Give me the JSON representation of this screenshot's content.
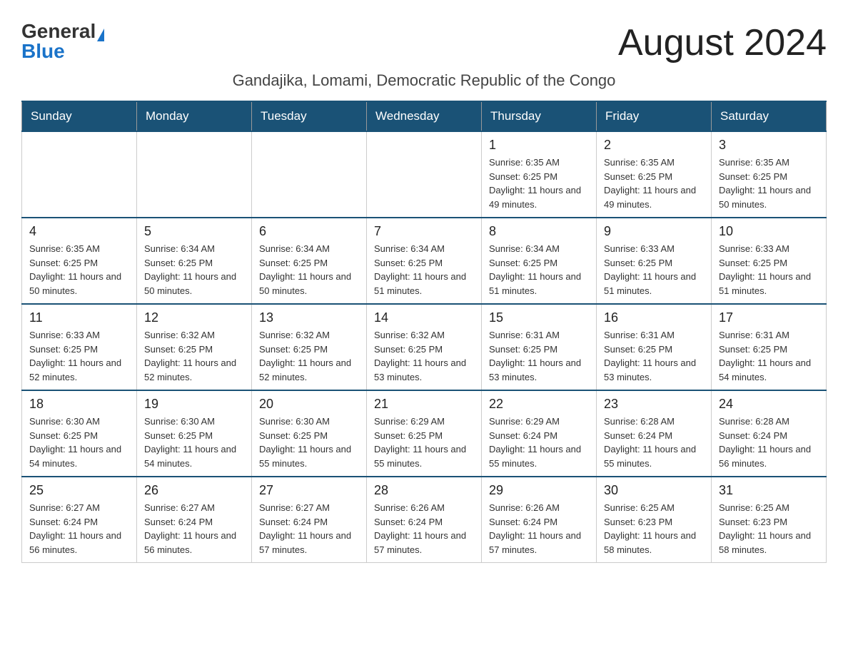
{
  "logo": {
    "general": "General",
    "blue": "Blue"
  },
  "title": "August 2024",
  "location": "Gandajika, Lomami, Democratic Republic of the Congo",
  "days_of_week": [
    "Sunday",
    "Monday",
    "Tuesday",
    "Wednesday",
    "Thursday",
    "Friday",
    "Saturday"
  ],
  "weeks": [
    [
      {
        "day": "",
        "info": ""
      },
      {
        "day": "",
        "info": ""
      },
      {
        "day": "",
        "info": ""
      },
      {
        "day": "",
        "info": ""
      },
      {
        "day": "1",
        "info": "Sunrise: 6:35 AM\nSunset: 6:25 PM\nDaylight: 11 hours and 49 minutes."
      },
      {
        "day": "2",
        "info": "Sunrise: 6:35 AM\nSunset: 6:25 PM\nDaylight: 11 hours and 49 minutes."
      },
      {
        "day": "3",
        "info": "Sunrise: 6:35 AM\nSunset: 6:25 PM\nDaylight: 11 hours and 50 minutes."
      }
    ],
    [
      {
        "day": "4",
        "info": "Sunrise: 6:35 AM\nSunset: 6:25 PM\nDaylight: 11 hours and 50 minutes."
      },
      {
        "day": "5",
        "info": "Sunrise: 6:34 AM\nSunset: 6:25 PM\nDaylight: 11 hours and 50 minutes."
      },
      {
        "day": "6",
        "info": "Sunrise: 6:34 AM\nSunset: 6:25 PM\nDaylight: 11 hours and 50 minutes."
      },
      {
        "day": "7",
        "info": "Sunrise: 6:34 AM\nSunset: 6:25 PM\nDaylight: 11 hours and 51 minutes."
      },
      {
        "day": "8",
        "info": "Sunrise: 6:34 AM\nSunset: 6:25 PM\nDaylight: 11 hours and 51 minutes."
      },
      {
        "day": "9",
        "info": "Sunrise: 6:33 AM\nSunset: 6:25 PM\nDaylight: 11 hours and 51 minutes."
      },
      {
        "day": "10",
        "info": "Sunrise: 6:33 AM\nSunset: 6:25 PM\nDaylight: 11 hours and 51 minutes."
      }
    ],
    [
      {
        "day": "11",
        "info": "Sunrise: 6:33 AM\nSunset: 6:25 PM\nDaylight: 11 hours and 52 minutes."
      },
      {
        "day": "12",
        "info": "Sunrise: 6:32 AM\nSunset: 6:25 PM\nDaylight: 11 hours and 52 minutes."
      },
      {
        "day": "13",
        "info": "Sunrise: 6:32 AM\nSunset: 6:25 PM\nDaylight: 11 hours and 52 minutes."
      },
      {
        "day": "14",
        "info": "Sunrise: 6:32 AM\nSunset: 6:25 PM\nDaylight: 11 hours and 53 minutes."
      },
      {
        "day": "15",
        "info": "Sunrise: 6:31 AM\nSunset: 6:25 PM\nDaylight: 11 hours and 53 minutes."
      },
      {
        "day": "16",
        "info": "Sunrise: 6:31 AM\nSunset: 6:25 PM\nDaylight: 11 hours and 53 minutes."
      },
      {
        "day": "17",
        "info": "Sunrise: 6:31 AM\nSunset: 6:25 PM\nDaylight: 11 hours and 54 minutes."
      }
    ],
    [
      {
        "day": "18",
        "info": "Sunrise: 6:30 AM\nSunset: 6:25 PM\nDaylight: 11 hours and 54 minutes."
      },
      {
        "day": "19",
        "info": "Sunrise: 6:30 AM\nSunset: 6:25 PM\nDaylight: 11 hours and 54 minutes."
      },
      {
        "day": "20",
        "info": "Sunrise: 6:30 AM\nSunset: 6:25 PM\nDaylight: 11 hours and 55 minutes."
      },
      {
        "day": "21",
        "info": "Sunrise: 6:29 AM\nSunset: 6:25 PM\nDaylight: 11 hours and 55 minutes."
      },
      {
        "day": "22",
        "info": "Sunrise: 6:29 AM\nSunset: 6:24 PM\nDaylight: 11 hours and 55 minutes."
      },
      {
        "day": "23",
        "info": "Sunrise: 6:28 AM\nSunset: 6:24 PM\nDaylight: 11 hours and 55 minutes."
      },
      {
        "day": "24",
        "info": "Sunrise: 6:28 AM\nSunset: 6:24 PM\nDaylight: 11 hours and 56 minutes."
      }
    ],
    [
      {
        "day": "25",
        "info": "Sunrise: 6:27 AM\nSunset: 6:24 PM\nDaylight: 11 hours and 56 minutes."
      },
      {
        "day": "26",
        "info": "Sunrise: 6:27 AM\nSunset: 6:24 PM\nDaylight: 11 hours and 56 minutes."
      },
      {
        "day": "27",
        "info": "Sunrise: 6:27 AM\nSunset: 6:24 PM\nDaylight: 11 hours and 57 minutes."
      },
      {
        "day": "28",
        "info": "Sunrise: 6:26 AM\nSunset: 6:24 PM\nDaylight: 11 hours and 57 minutes."
      },
      {
        "day": "29",
        "info": "Sunrise: 6:26 AM\nSunset: 6:24 PM\nDaylight: 11 hours and 57 minutes."
      },
      {
        "day": "30",
        "info": "Sunrise: 6:25 AM\nSunset: 6:23 PM\nDaylight: 11 hours and 58 minutes."
      },
      {
        "day": "31",
        "info": "Sunrise: 6:25 AM\nSunset: 6:23 PM\nDaylight: 11 hours and 58 minutes."
      }
    ]
  ]
}
